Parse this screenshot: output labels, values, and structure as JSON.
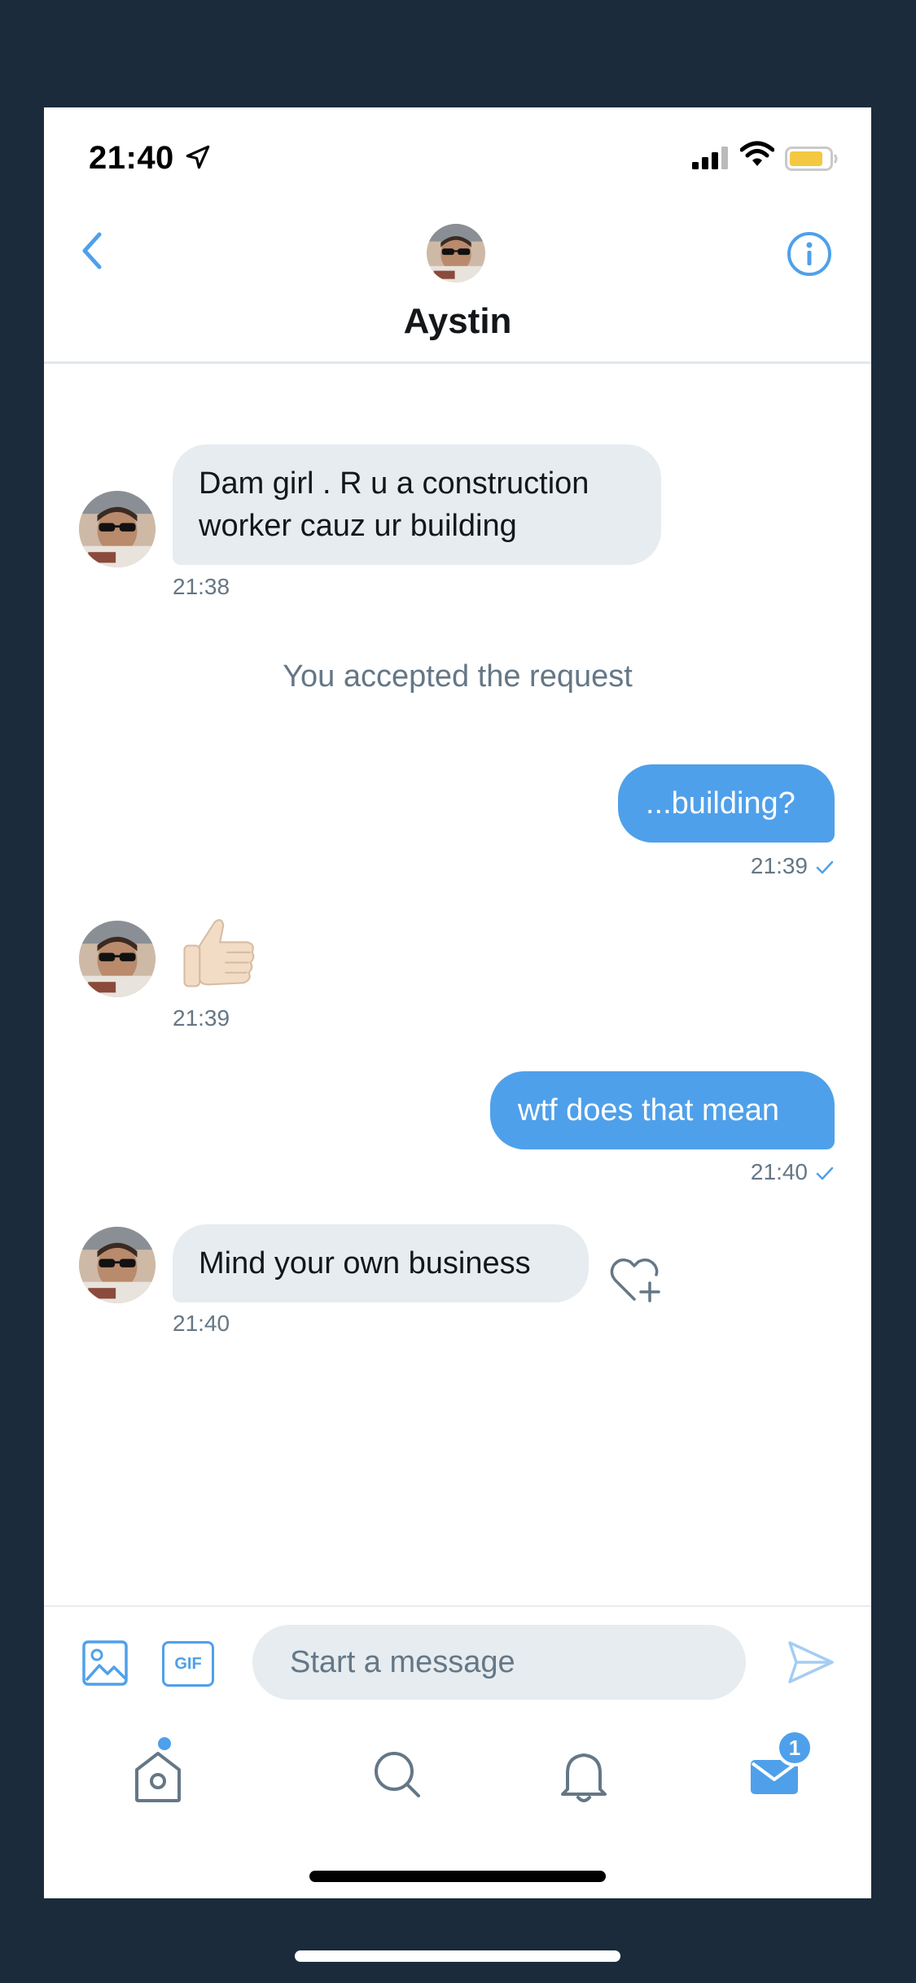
{
  "status_bar": {
    "time": "21:40",
    "icons": [
      "location-arrow-icon",
      "cellular-signal-icon",
      "wifi-icon",
      "battery-icon"
    ],
    "battery_color": "#f5c842"
  },
  "header": {
    "contact_name": "Aystin",
    "back_icon": "chevron-left-icon",
    "info_icon": "info-icon",
    "accent_color": "#4fa0ea"
  },
  "conversation": {
    "messages": [
      {
        "direction": "received",
        "text": "Dam girl . R u a construction worker cauz ur building",
        "line1": "Dam girl . R u a construction",
        "line2": "worker cauz ur building",
        "time": "21:38"
      },
      {
        "direction": "system",
        "text": "You accepted the request"
      },
      {
        "direction": "sent",
        "text": "...building?",
        "time": "21:39"
      },
      {
        "direction": "received",
        "emoji": "thumbs-up-icon",
        "time": "21:39"
      },
      {
        "direction": "sent",
        "text": "wtf does that mean",
        "time": "21:40"
      },
      {
        "direction": "received",
        "text": "Mind your own business",
        "time": "21:40",
        "reaction_icon": "heart-add-icon"
      }
    ]
  },
  "composer": {
    "placeholder": "Start a message",
    "gif_label": "GIF",
    "media_icon": "image-icon",
    "send_icon": "send-icon"
  },
  "tab_bar": {
    "tabs": [
      "home-icon",
      "search-icon",
      "notifications-icon",
      "messages-icon"
    ],
    "messages_badge": "1"
  }
}
